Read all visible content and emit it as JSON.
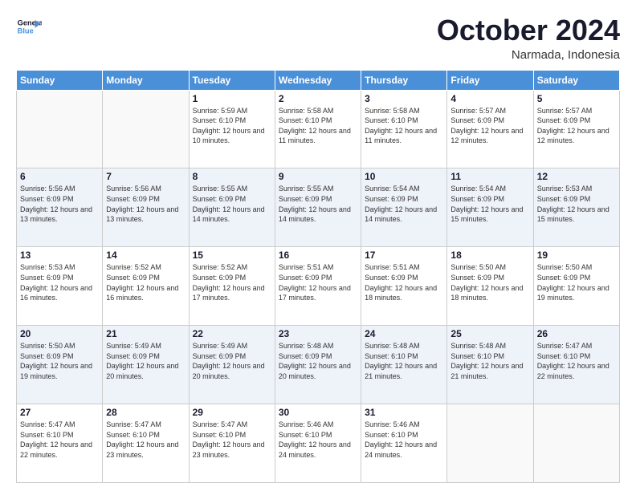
{
  "header": {
    "logo_line1": "General",
    "logo_line2": "Blue",
    "month": "October 2024",
    "location": "Narmada, Indonesia"
  },
  "days_of_week": [
    "Sunday",
    "Monday",
    "Tuesday",
    "Wednesday",
    "Thursday",
    "Friday",
    "Saturday"
  ],
  "weeks": [
    [
      {
        "day": "",
        "sunrise": "",
        "sunset": "",
        "daylight": ""
      },
      {
        "day": "",
        "sunrise": "",
        "sunset": "",
        "daylight": ""
      },
      {
        "day": "1",
        "sunrise": "Sunrise: 5:59 AM",
        "sunset": "Sunset: 6:10 PM",
        "daylight": "Daylight: 12 hours and 10 minutes."
      },
      {
        "day": "2",
        "sunrise": "Sunrise: 5:58 AM",
        "sunset": "Sunset: 6:10 PM",
        "daylight": "Daylight: 12 hours and 11 minutes."
      },
      {
        "day": "3",
        "sunrise": "Sunrise: 5:58 AM",
        "sunset": "Sunset: 6:10 PM",
        "daylight": "Daylight: 12 hours and 11 minutes."
      },
      {
        "day": "4",
        "sunrise": "Sunrise: 5:57 AM",
        "sunset": "Sunset: 6:09 PM",
        "daylight": "Daylight: 12 hours and 12 minutes."
      },
      {
        "day": "5",
        "sunrise": "Sunrise: 5:57 AM",
        "sunset": "Sunset: 6:09 PM",
        "daylight": "Daylight: 12 hours and 12 minutes."
      }
    ],
    [
      {
        "day": "6",
        "sunrise": "Sunrise: 5:56 AM",
        "sunset": "Sunset: 6:09 PM",
        "daylight": "Daylight: 12 hours and 13 minutes."
      },
      {
        "day": "7",
        "sunrise": "Sunrise: 5:56 AM",
        "sunset": "Sunset: 6:09 PM",
        "daylight": "Daylight: 12 hours and 13 minutes."
      },
      {
        "day": "8",
        "sunrise": "Sunrise: 5:55 AM",
        "sunset": "Sunset: 6:09 PM",
        "daylight": "Daylight: 12 hours and 14 minutes."
      },
      {
        "day": "9",
        "sunrise": "Sunrise: 5:55 AM",
        "sunset": "Sunset: 6:09 PM",
        "daylight": "Daylight: 12 hours and 14 minutes."
      },
      {
        "day": "10",
        "sunrise": "Sunrise: 5:54 AM",
        "sunset": "Sunset: 6:09 PM",
        "daylight": "Daylight: 12 hours and 14 minutes."
      },
      {
        "day": "11",
        "sunrise": "Sunrise: 5:54 AM",
        "sunset": "Sunset: 6:09 PM",
        "daylight": "Daylight: 12 hours and 15 minutes."
      },
      {
        "day": "12",
        "sunrise": "Sunrise: 5:53 AM",
        "sunset": "Sunset: 6:09 PM",
        "daylight": "Daylight: 12 hours and 15 minutes."
      }
    ],
    [
      {
        "day": "13",
        "sunrise": "Sunrise: 5:53 AM",
        "sunset": "Sunset: 6:09 PM",
        "daylight": "Daylight: 12 hours and 16 minutes."
      },
      {
        "day": "14",
        "sunrise": "Sunrise: 5:52 AM",
        "sunset": "Sunset: 6:09 PM",
        "daylight": "Daylight: 12 hours and 16 minutes."
      },
      {
        "day": "15",
        "sunrise": "Sunrise: 5:52 AM",
        "sunset": "Sunset: 6:09 PM",
        "daylight": "Daylight: 12 hours and 17 minutes."
      },
      {
        "day": "16",
        "sunrise": "Sunrise: 5:51 AM",
        "sunset": "Sunset: 6:09 PM",
        "daylight": "Daylight: 12 hours and 17 minutes."
      },
      {
        "day": "17",
        "sunrise": "Sunrise: 5:51 AM",
        "sunset": "Sunset: 6:09 PM",
        "daylight": "Daylight: 12 hours and 18 minutes."
      },
      {
        "day": "18",
        "sunrise": "Sunrise: 5:50 AM",
        "sunset": "Sunset: 6:09 PM",
        "daylight": "Daylight: 12 hours and 18 minutes."
      },
      {
        "day": "19",
        "sunrise": "Sunrise: 5:50 AM",
        "sunset": "Sunset: 6:09 PM",
        "daylight": "Daylight: 12 hours and 19 minutes."
      }
    ],
    [
      {
        "day": "20",
        "sunrise": "Sunrise: 5:50 AM",
        "sunset": "Sunset: 6:09 PM",
        "daylight": "Daylight: 12 hours and 19 minutes."
      },
      {
        "day": "21",
        "sunrise": "Sunrise: 5:49 AM",
        "sunset": "Sunset: 6:09 PM",
        "daylight": "Daylight: 12 hours and 20 minutes."
      },
      {
        "day": "22",
        "sunrise": "Sunrise: 5:49 AM",
        "sunset": "Sunset: 6:09 PM",
        "daylight": "Daylight: 12 hours and 20 minutes."
      },
      {
        "day": "23",
        "sunrise": "Sunrise: 5:48 AM",
        "sunset": "Sunset: 6:09 PM",
        "daylight": "Daylight: 12 hours and 20 minutes."
      },
      {
        "day": "24",
        "sunrise": "Sunrise: 5:48 AM",
        "sunset": "Sunset: 6:10 PM",
        "daylight": "Daylight: 12 hours and 21 minutes."
      },
      {
        "day": "25",
        "sunrise": "Sunrise: 5:48 AM",
        "sunset": "Sunset: 6:10 PM",
        "daylight": "Daylight: 12 hours and 21 minutes."
      },
      {
        "day": "26",
        "sunrise": "Sunrise: 5:47 AM",
        "sunset": "Sunset: 6:10 PM",
        "daylight": "Daylight: 12 hours and 22 minutes."
      }
    ],
    [
      {
        "day": "27",
        "sunrise": "Sunrise: 5:47 AM",
        "sunset": "Sunset: 6:10 PM",
        "daylight": "Daylight: 12 hours and 22 minutes."
      },
      {
        "day": "28",
        "sunrise": "Sunrise: 5:47 AM",
        "sunset": "Sunset: 6:10 PM",
        "daylight": "Daylight: 12 hours and 23 minutes."
      },
      {
        "day": "29",
        "sunrise": "Sunrise: 5:47 AM",
        "sunset": "Sunset: 6:10 PM",
        "daylight": "Daylight: 12 hours and 23 minutes."
      },
      {
        "day": "30",
        "sunrise": "Sunrise: 5:46 AM",
        "sunset": "Sunset: 6:10 PM",
        "daylight": "Daylight: 12 hours and 24 minutes."
      },
      {
        "day": "31",
        "sunrise": "Sunrise: 5:46 AM",
        "sunset": "Sunset: 6:10 PM",
        "daylight": "Daylight: 12 hours and 24 minutes."
      },
      {
        "day": "",
        "sunrise": "",
        "sunset": "",
        "daylight": ""
      },
      {
        "day": "",
        "sunrise": "",
        "sunset": "",
        "daylight": ""
      }
    ]
  ]
}
